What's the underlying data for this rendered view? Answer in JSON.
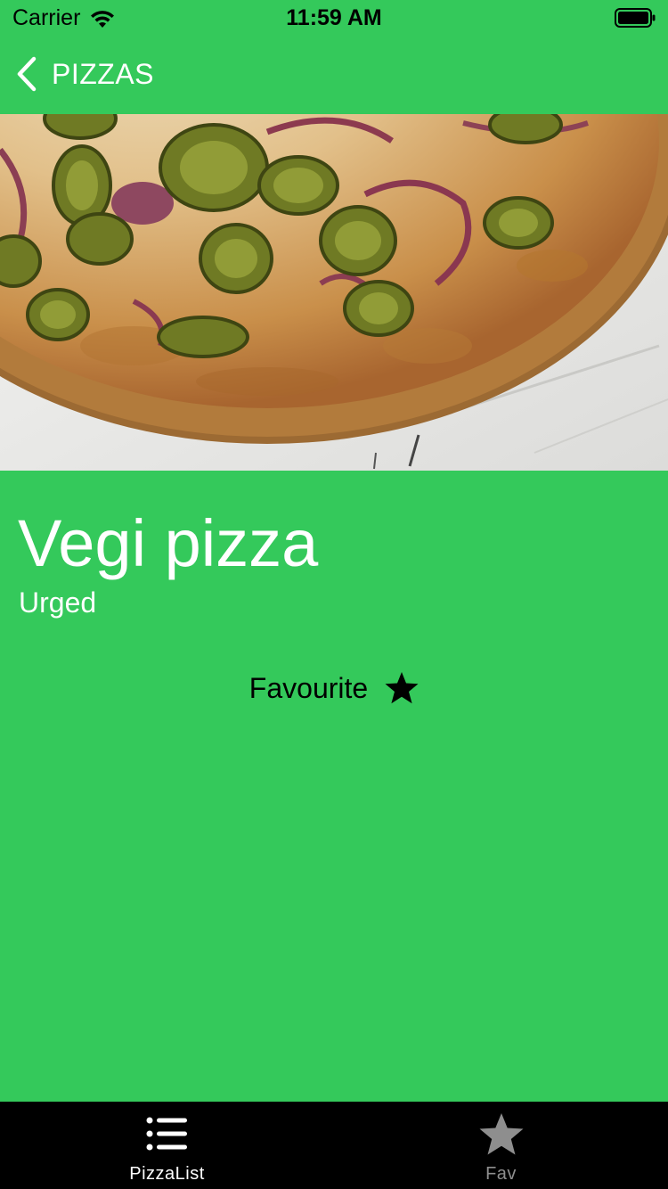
{
  "status_bar": {
    "carrier": "Carrier",
    "time": "11:59 AM"
  },
  "nav": {
    "back_label": "PIZZAS"
  },
  "detail": {
    "title": "Vegi pizza",
    "subtitle": "Urged",
    "favourite_label": "Favourite"
  },
  "tabs": [
    {
      "label": "PizzaList",
      "icon": "list-icon",
      "selected": true
    },
    {
      "label": "Fav",
      "icon": "star-icon",
      "selected": false
    }
  ],
  "colors": {
    "background": "#34c95b",
    "tab_bar": "#000000",
    "tab_selected": "#ffffff",
    "tab_unselected": "#8e8e8e"
  }
}
